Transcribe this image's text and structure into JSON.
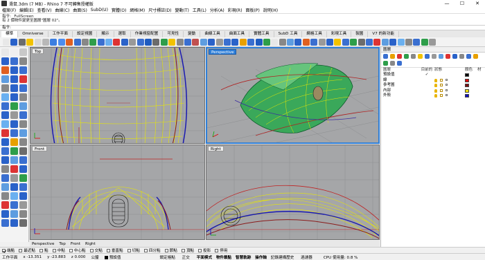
{
  "window": {
    "title": "滑鼠.3dm (7 MB) - Rhino 7 不可轉售授權版",
    "min": "—",
    "max": "☐",
    "close": "✕"
  },
  "menu": [
    "檔案(F)",
    "編輯(E)",
    "查看(V)",
    "曲線(C)",
    "曲面(S)",
    "SubD(U)",
    "實體(O)",
    "網格(M)",
    "尺寸標註(D)",
    "變動(T)",
    "工具(L)",
    "分析(A)",
    "彩現(R)",
    "面板(P)",
    "說明(H)"
  ],
  "command": {
    "history": [
      "指令: _FullScreen",
      "有 2 個物件變更至圖層\"圖層 02\"。"
    ],
    "prompt": "指令:"
  },
  "tabs": [
    "標準",
    "Omniverse",
    "工作平面",
    "設定視圖",
    "顯示",
    "選取",
    "作業視窗配置",
    "可見性",
    "變動",
    "曲線工具",
    "曲面工具",
    "實體工具",
    "SubD 工具",
    "網格工具",
    "彩現工具",
    "製圖",
    "V7 的新功能"
  ],
  "toolbar_colors": [
    "#e8e8e8",
    "#2a62c9",
    "#6c6c6c",
    "#f2c200",
    "#d9d9d9",
    "#b8b8b8",
    "#3c7ee0",
    "#4c8df0",
    "#e06020",
    "#3a6fd0",
    "#888",
    "#2e9e4a",
    "#3a6fd0",
    "#6ab0f0",
    "#d33",
    "#2a62c9",
    "#999",
    "#3a6fd0",
    "#1e5bc0",
    "#6b6b6b",
    "#2e9e4a",
    "#f2c200",
    "#888",
    "#3a6fd0",
    "#c05050",
    "#5e9de0",
    "#2a62c9",
    "#999",
    "#3a6fd0",
    "#2a62c9",
    "#e8a000",
    "#3a6fd0",
    "#1e5bc0",
    "#2e9e4a",
    "#e8e8e8",
    "#888",
    "#5e9de0",
    "#2a62c9",
    "#e06020",
    "#3a6fd0",
    "#999",
    "#2a62c9",
    "#f2c200",
    "#3a6fd0",
    "#2e9e4a",
    "#6c6c6c",
    "#3a6fd0",
    "#d33",
    "#5e9de0",
    "#2a62c9",
    "#6ab0f0",
    "#888",
    "#3a6fd0",
    "#2e9e4a",
    "#999"
  ],
  "left_tool_colors": [
    "#e8e8e8",
    "#f0f0f0",
    "#c8c8c8",
    "#2a62c9",
    "#3a6fd0",
    "#888",
    "#e06020",
    "#2a62c9",
    "#3a6fd0",
    "#5e9de0",
    "#2a62c9",
    "#d33",
    "#888",
    "#2a62c9",
    "#3a6fd0",
    "#6ab0f0",
    "#2a62c9",
    "#888",
    "#3a6fd0",
    "#2e9e4a",
    "#5e9de0",
    "#2a62c9",
    "#999",
    "#3a6fd0",
    "#6ab0f0",
    "#2a62c9",
    "#888",
    "#d33",
    "#3a6fd0",
    "#5e9de0",
    "#2a62c9",
    "#e8a000",
    "#888",
    "#3a6fd0",
    "#2e9e4a",
    "#6c6c6c",
    "#2a62c9",
    "#5e9de0",
    "#3a6fd0",
    "#888",
    "#d33",
    "#2a62c9",
    "#3a6fd0",
    "#999",
    "#2e9e4a",
    "#5e9de0",
    "#2a62c9",
    "#3a6fd0",
    "#888",
    "#6ab0f0",
    "#2a62c9",
    "#d33",
    "#3a6fd0",
    "#999",
    "#2a62c9",
    "#5e9de0",
    "#888",
    "#3a6fd0",
    "#2a62c9",
    "#6c6c6c"
  ],
  "viewports": {
    "top": "Top",
    "perspective": "Perspective",
    "front": "Front",
    "right": "Right"
  },
  "viewport_tabs": [
    "Perspective",
    "Top",
    "Front",
    "Right"
  ],
  "panel": {
    "title": "圖層",
    "icon_colors": [
      "#3a6fd0",
      "#e8a000",
      "#d33",
      "#2e9e4a",
      "#888",
      "#f2c200",
      "#3a6fd0",
      "#999",
      "#5e9de0",
      "#d33",
      "#2a62c9",
      "#888",
      "#3a6fd0",
      "#e8a000",
      "#2e9e4a",
      "#888",
      "#3a6fd0"
    ],
    "headers": {
      "name": "圖層",
      "current": "目前的",
      "state": "狀態",
      "color": "顏色",
      "material": "材"
    },
    "layers": [
      {
        "name": "預設值",
        "current": "✓",
        "color": "#000000",
        "state": false
      },
      {
        "name": "線",
        "current": "",
        "color": "#e00000",
        "state": true
      },
      {
        "name": "參考圖",
        "current": "",
        "color": "#7a1010",
        "state": true
      },
      {
        "name": "內部",
        "current": "",
        "color": "#f2e400",
        "state": true
      },
      {
        "name": "外殼",
        "current": "",
        "color": "#1010c0",
        "state": true
      }
    ]
  },
  "osnap": [
    {
      "label": "端點",
      "on": true
    },
    {
      "label": "最近點",
      "on": false
    },
    {
      "label": "點",
      "on": false
    },
    {
      "label": "中點",
      "on": false
    },
    {
      "label": "中心點",
      "on": false
    },
    {
      "label": "交點",
      "on": false
    },
    {
      "label": "垂直點",
      "on": false
    },
    {
      "label": "切點",
      "on": false
    },
    {
      "label": "四分點",
      "on": false
    },
    {
      "label": "節點",
      "on": false
    },
    {
      "label": "頂點",
      "on": false
    },
    {
      "label": "投影",
      "on": false
    },
    {
      "label": "停用",
      "on": false
    }
  ],
  "status": {
    "cplane": "工作平面",
    "x": "x -13.351",
    "y": "y -23.883",
    "z": "z 0.000",
    "units": "公釐",
    "layer": "預設值",
    "toggles": [
      "鎖定格點",
      "正交",
      "平面模式",
      "物件鎖點",
      "智慧軌跡",
      "操作軸",
      "記錄建構歷史",
      "過濾器"
    ],
    "cpu": "CPU 使用量: 0.8 %"
  }
}
